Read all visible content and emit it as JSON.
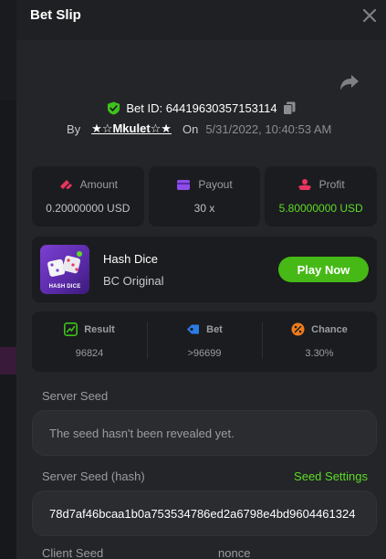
{
  "header": {
    "title": "Bet Slip"
  },
  "bet": {
    "id_text": "Bet ID: 64419630357153114",
    "by_label": "By",
    "user": "★☆Mkulet☆★",
    "on_label": "On",
    "date": "5/31/2022, 10:40:53 AM"
  },
  "stats": {
    "amount": {
      "label": "Amount",
      "value": "0.20000000 USD",
      "icon": "amount-icon"
    },
    "payout": {
      "label": "Payout",
      "value": "30 x",
      "icon": "wallet-icon"
    },
    "profit": {
      "label": "Profit",
      "value": "5.80000000 USD",
      "icon": "coins-icon"
    }
  },
  "game": {
    "name": "Hash Dice",
    "provider": "BC Original",
    "thumb_label": "HASH DICE",
    "play_label": "Play Now"
  },
  "result": {
    "result": {
      "label": "Result",
      "value": "96824"
    },
    "bet": {
      "label": "Bet",
      "value": ">96699"
    },
    "chance": {
      "label": "Chance",
      "value": "3.30%"
    }
  },
  "seeds": {
    "server_seed_label": "Server Seed",
    "server_seed_value": "The seed hasn't been revealed yet.",
    "server_hash_label": "Server Seed (hash)",
    "seed_settings_label": "Seed Settings",
    "server_hash_value": "78d7af46bcaa1b0a753534786ed2a6798e4bd9604461324",
    "client_seed_label": "Client Seed",
    "nonce_label": "nonce"
  },
  "colors": {
    "accent_green": "#5ddb27",
    "play_button": "#47b916",
    "panel": "#232528",
    "card": "#1b1c1f"
  }
}
